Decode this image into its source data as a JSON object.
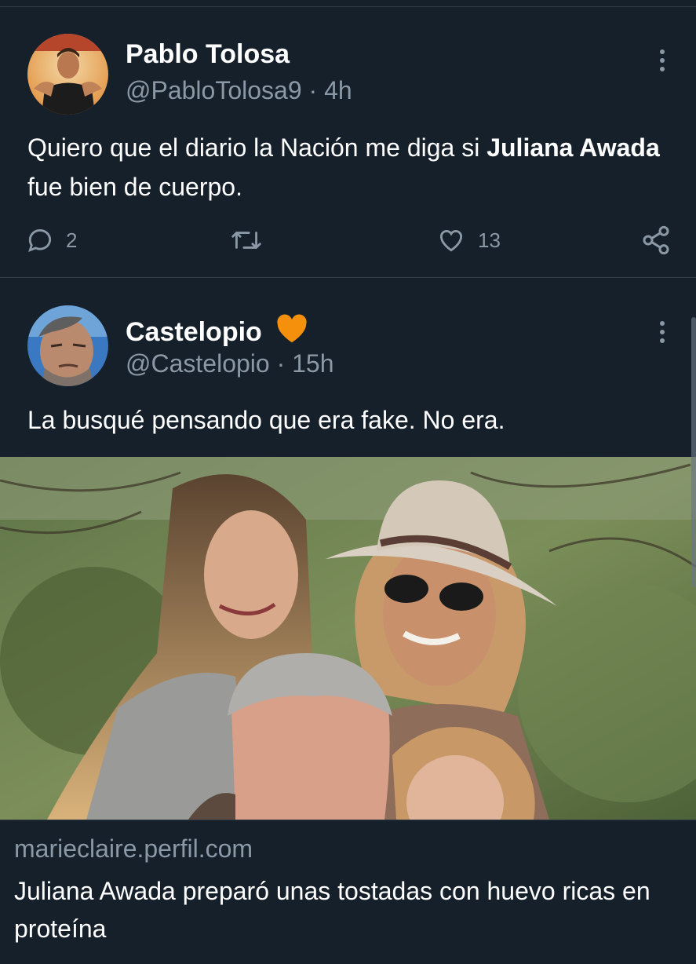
{
  "tweets": [
    {
      "name": "Pablo Tolosa",
      "handle": "@PabloTolosa9 · 4h",
      "text_part1": "Quiero que el diario la Nación me diga si ",
      "text_bold": "Juliana Awada",
      "text_part2": " fue bien de cuerpo.",
      "replies": "2",
      "likes": "13"
    },
    {
      "name": "Castelopio",
      "verified_badge_color": "#f4900c",
      "handle": "@Castelopio · 15h",
      "text": "La busqué pensando que era fake. No era.",
      "card": {
        "domain": "marieclaire.perfil.com",
        "title": "Juliana Awada preparó unas tostadas con huevo ricas en proteína"
      }
    }
  ],
  "colors": {
    "background": "#15202b",
    "secondary_text": "#8b98a5",
    "divider": "#2f3b47"
  }
}
